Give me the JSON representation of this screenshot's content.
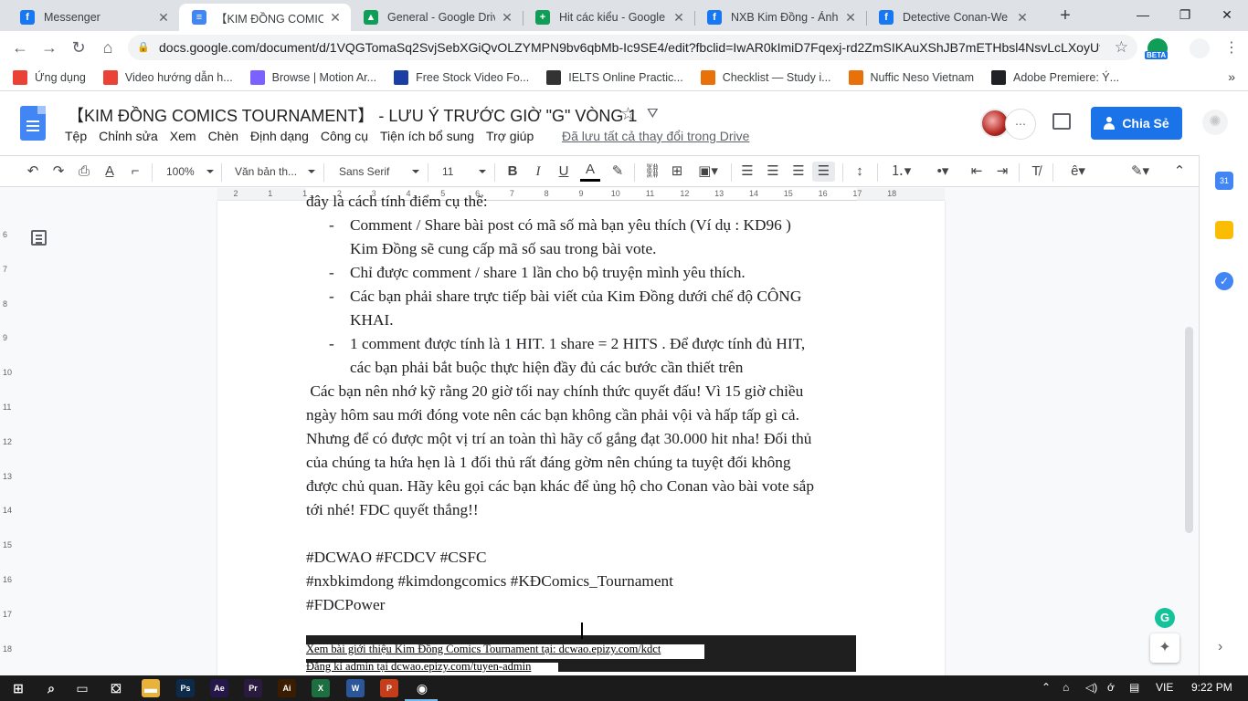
{
  "tabs": [
    {
      "title": "Messenger",
      "icon": "facebook-icon",
      "color": "#1877f2",
      "glyph": "f"
    },
    {
      "title": "【KIM ĐỒNG COMICS TO",
      "icon": "google-docs-icon",
      "color": "#4285f4",
      "glyph": "≡",
      "active": true
    },
    {
      "title": "General - Google Drive",
      "icon": "google-drive-icon",
      "color": "#0f9d58",
      "glyph": "▲"
    },
    {
      "title": "Hit các kiểu - Google Tr",
      "icon": "google-sheets-icon",
      "color": "#0f9d58",
      "glyph": "+"
    },
    {
      "title": "NXB Kim Đồng - Ảnh",
      "icon": "facebook-icon",
      "color": "#1877f2",
      "glyph": "f"
    },
    {
      "title": "Detective Conan-We Ar",
      "icon": "facebook-icon",
      "color": "#1877f2",
      "glyph": "f"
    }
  ],
  "address_bar": {
    "url": "docs.google.com/document/d/1VQGTomaSq2SvjSebXGiQvOLZYMPN9bv6qbMb-Ic9SE4/edit?fbclid=IwAR0kImiD7Fqexj-rd2ZmSIKAuXShJB7mETHbsl4NsvLcLXoyUtN...",
    "ext_badge": "BETA"
  },
  "bookmarks": [
    {
      "label": "Ứng dụng",
      "icon": "apps-grid-icon"
    },
    {
      "label": "Video hướng dẫn h...",
      "icon": "video-icon"
    },
    {
      "label": "Browse | Motion Ar...",
      "icon": "motion-array-icon"
    },
    {
      "label": "Free Stock Video Fo...",
      "icon": "videvo-icon"
    },
    {
      "label": "IELTS Online Practic...",
      "icon": "ielts-icon"
    },
    {
      "label": "Checklist — Study i...",
      "icon": "checklist-icon"
    },
    {
      "label": "Nuffic Neso Vietnam",
      "icon": "nuffic-icon"
    },
    {
      "label": "Adobe Premiere: Ý...",
      "icon": "github-icon"
    }
  ],
  "doc": {
    "title": "【KIM ĐỒNG COMICS TOURNAMENT】 - LƯU Ý TRƯỚC GIỜ \"G\" VÒNG 1",
    "menu": [
      "Tệp",
      "Chỉnh sửa",
      "Xem",
      "Chèn",
      "Định dạng",
      "Công cụ",
      "Tiện ích bổ sung",
      "Trợ giúp"
    ],
    "saved_status": "Đã lưu tất cả thay đổi trong Drive",
    "share_label": "Chia Sẻ"
  },
  "toolbar": {
    "zoom": "100%",
    "style": "Văn bản th...",
    "font": "Sans Serif",
    "size": "11"
  },
  "ruler": {
    "h": [
      "2",
      "1",
      "1",
      "2",
      "3",
      "4",
      "5",
      "6",
      "7",
      "8",
      "9",
      "10",
      "11",
      "12",
      "13",
      "14",
      "15",
      "16",
      "17",
      "18"
    ],
    "v": [
      "6",
      "7",
      "8",
      "9",
      "10",
      "11",
      "12",
      "13",
      "14",
      "15",
      "16",
      "17",
      "18"
    ]
  },
  "content": {
    "cut_line": "đây là cách tính điểm cụ thể:",
    "bullets": [
      {
        "dash": "-",
        "lines": [
          "Comment / Share bài post có mã số mà bạn yêu thích (Ví dụ : KD96 )",
          "Kim Đồng sẽ cung cấp mã số sau trong bài vote."
        ]
      },
      {
        "dash": "-",
        "lines": [
          "Chỉ được comment / share 1 lần cho bộ truyện mình yêu thích."
        ]
      },
      {
        "dash": "-",
        "lines": [
          "Các bạn phải share trực tiếp bài viết của Kim Đồng dưới chế độ CÔNG",
          "KHAI."
        ]
      },
      {
        "dash": "-",
        "lines": [
          "1 comment được tính là 1 HIT. 1 share = 2 HITS . Để được tính đủ HIT,",
          "các bạn phải bắt buộc thực hiện đầy đủ các bước cần thiết trên"
        ]
      }
    ],
    "paragraph": [
      " Các bạn nên nhớ kỹ rằng 20 giờ tối nay chính thức quyết đấu! Vì 15 giờ chiều",
      "ngày hôm sau mới đóng vote nên các bạn không cần phải vội và hấp tấp gì cả.",
      "Nhưng để có được một vị trí an toàn thì hãy cố gắng đạt 30.000 hit nha! Đối thủ",
      "của chúng ta hứa hẹn là 1 đối thủ rất đáng gờm nên chúng ta tuyệt đối không",
      "được chủ quan. Hãy kêu gọi các bạn khác để ủng hộ cho Conan vào bài vote sắp",
      "tới nhé! FDC quyết thắng!!"
    ],
    "hashtags": [
      "#DCWAO #FCDCV #CSFC",
      "#nxbkimdong #kimdongcomics #KĐComics_Tournament",
      "#FDCPower"
    ],
    "footer": [
      "Xem bài giới thiệu Kim Đồng Comics Tournament tại: dcwao.epizy.com/kdct",
      "Đăng kí admin tại dcwao.epizy.com/tuyen-admin"
    ]
  },
  "taskbar": {
    "apps": [
      {
        "name": "windows-start-icon",
        "label": "",
        "color": "#1b1b1b"
      },
      {
        "name": "search-icon",
        "label": "",
        "color": "#1b1b1b"
      },
      {
        "name": "task-view-icon",
        "label": "",
        "color": "#1b1b1b"
      },
      {
        "name": "store-icon",
        "label": "",
        "color": "#1b1b1b"
      },
      {
        "name": "file-explorer-icon",
        "label": "",
        "color": "#e8b23b"
      },
      {
        "name": "photoshop-icon",
        "label": "Ps",
        "color": "#0c2a4a"
      },
      {
        "name": "after-effects-icon",
        "label": "Ae",
        "color": "#26174a"
      },
      {
        "name": "premiere-icon",
        "label": "Pr",
        "color": "#2b1a40"
      },
      {
        "name": "illustrator-icon",
        "label": "Ai",
        "color": "#3a1d00"
      },
      {
        "name": "excel-icon",
        "label": "X",
        "color": "#1d6f42"
      },
      {
        "name": "word-icon",
        "label": "W",
        "color": "#2b579a"
      },
      {
        "name": "powerpoint-icon",
        "label": "P",
        "color": "#c43e1c"
      },
      {
        "name": "chrome-icon",
        "label": "",
        "color": "#1b1b1b"
      }
    ],
    "language": "VIE",
    "time": "9:22 PM"
  }
}
